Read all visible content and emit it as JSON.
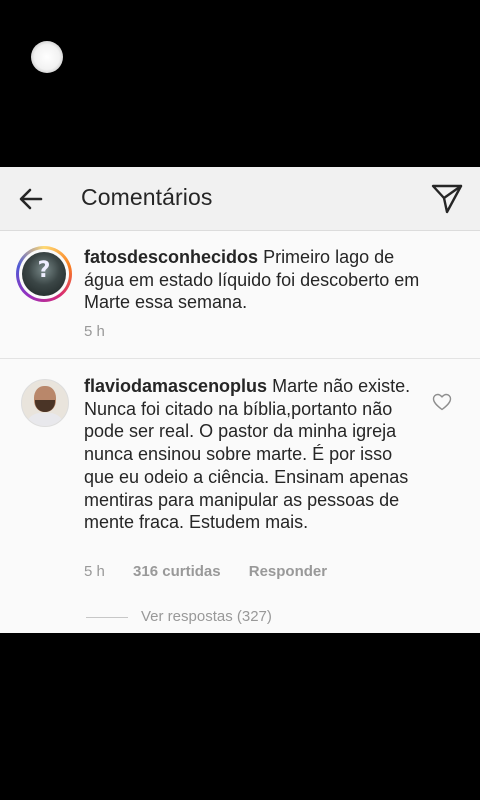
{
  "header": {
    "title": "Comentários",
    "back_icon": "arrow-left-icon",
    "send_icon": "paper-plane-icon"
  },
  "caption": {
    "username": "fatosdesconhecidos",
    "text": "Primeiro lago de água em estado líquido foi descoberto em Marte essa semana.",
    "time": "5 h"
  },
  "comment": {
    "username": "flaviodamascenoplus",
    "text": "Marte não existe. Nunca foi citado na bíblia,portanto não pode ser real. O pastor da minha igreja nunca ensinou sobre marte. É por isso que eu odeio a ciência. Ensinam apenas mentiras para manipular as pessoas de mente fraca. Estudem mais.",
    "time": "5 h",
    "likes": "316 curtidas",
    "reply_label": "Responder",
    "view_replies": "Ver respostas (327)",
    "like_icon": "heart-outline-icon"
  },
  "colors": {
    "text": "#262626",
    "secondary": "#999999",
    "background": "#fafafa",
    "header_bg": "#f1f1f1"
  }
}
